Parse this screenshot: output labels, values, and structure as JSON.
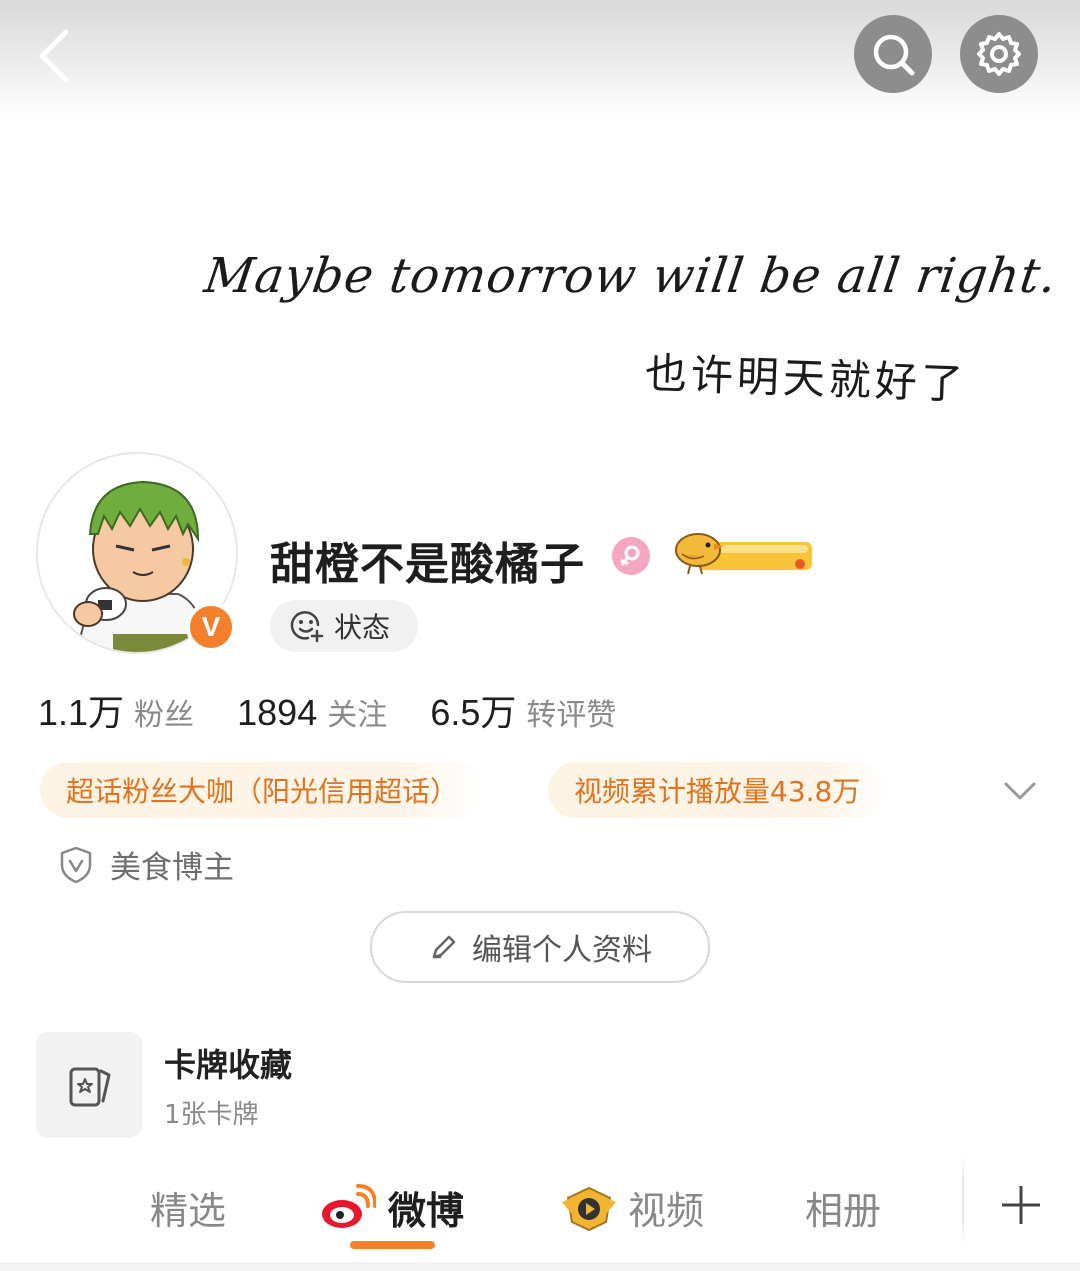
{
  "header": {
    "back_icon": "chevron-left-icon",
    "search_icon": "search-icon",
    "settings_icon": "gear-icon"
  },
  "banner": {
    "script_text": "Maybe tomorrow will be all right.",
    "cn_text": "也许明天就好了"
  },
  "profile": {
    "username": "甜橙不是酸橘子",
    "verified_badge": "V",
    "gender_icon": "female-icon",
    "medal_icon": "bird-medal-icon",
    "status_label": "状态"
  },
  "stats": [
    {
      "value": "1.1万",
      "label": "粉丝"
    },
    {
      "value": "1894",
      "label": "关注"
    },
    {
      "value": "6.5万",
      "label": "转评赞"
    }
  ],
  "tags": [
    {
      "label": "超话粉丝大咖（阳光信用超话）"
    },
    {
      "label": "视频累计播放量43.8万"
    }
  ],
  "role": {
    "label": "美食博主",
    "icon": "shield-v-icon"
  },
  "edit_button": {
    "label": "编辑个人资料",
    "icon": "pencil-icon"
  },
  "card_collection": {
    "title": "卡牌收藏",
    "subtitle": "1张卡牌",
    "icon": "card-icon"
  },
  "tabs": [
    {
      "label": "精选"
    },
    {
      "label": "微博",
      "icon": "weibo-icon",
      "active": true
    },
    {
      "label": "视频",
      "icon": "video-badge-icon"
    },
    {
      "label": "相册"
    }
  ],
  "colors": {
    "accent": "#f4802b",
    "tag_text": "#e0731e",
    "tag_bg": "#fdf3e4"
  }
}
